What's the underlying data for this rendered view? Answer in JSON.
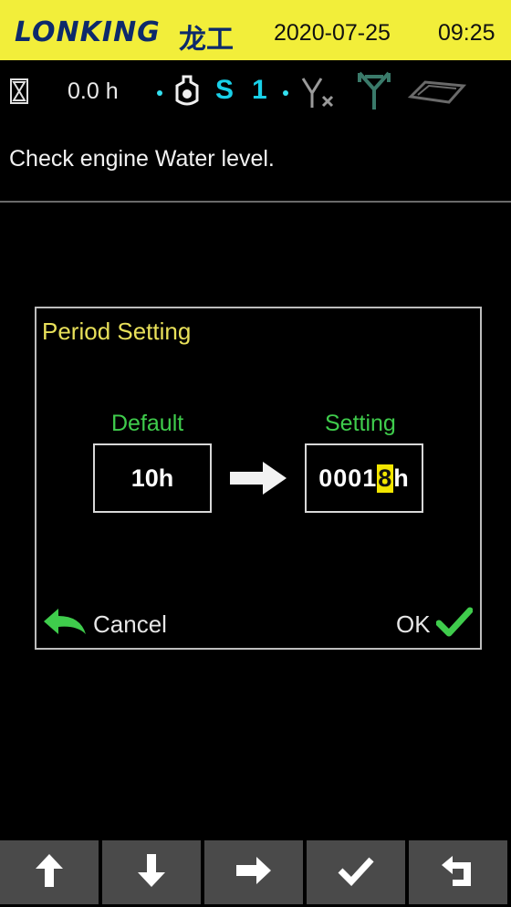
{
  "header": {
    "brand": "LONKING",
    "brand_cn": "龙工",
    "date": "2020-07-25",
    "time": "09:25",
    "background": "#f2ee3a"
  },
  "status": {
    "hours": "0.0 h",
    "gear_letter": "S",
    "gear_number": "1"
  },
  "message": "Check engine Water level.",
  "dialog": {
    "title": "Period Setting",
    "default_label": "Default",
    "default_value": "10h",
    "setting_label": "Setting",
    "setting_prefix": "0001",
    "setting_cursor_digit": "8",
    "setting_suffix": "h",
    "cancel_label": "Cancel",
    "ok_label": "OK"
  },
  "keys": [
    "up-arrow-icon",
    "down-arrow-icon",
    "right-arrow-icon",
    "check-icon",
    "return-icon"
  ],
  "colors": {
    "accent_green": "#3fcc4c",
    "title_yellow": "#e8e05a",
    "gear_cyan": "#19d0e8",
    "key_gray": "#4a4a4a"
  }
}
